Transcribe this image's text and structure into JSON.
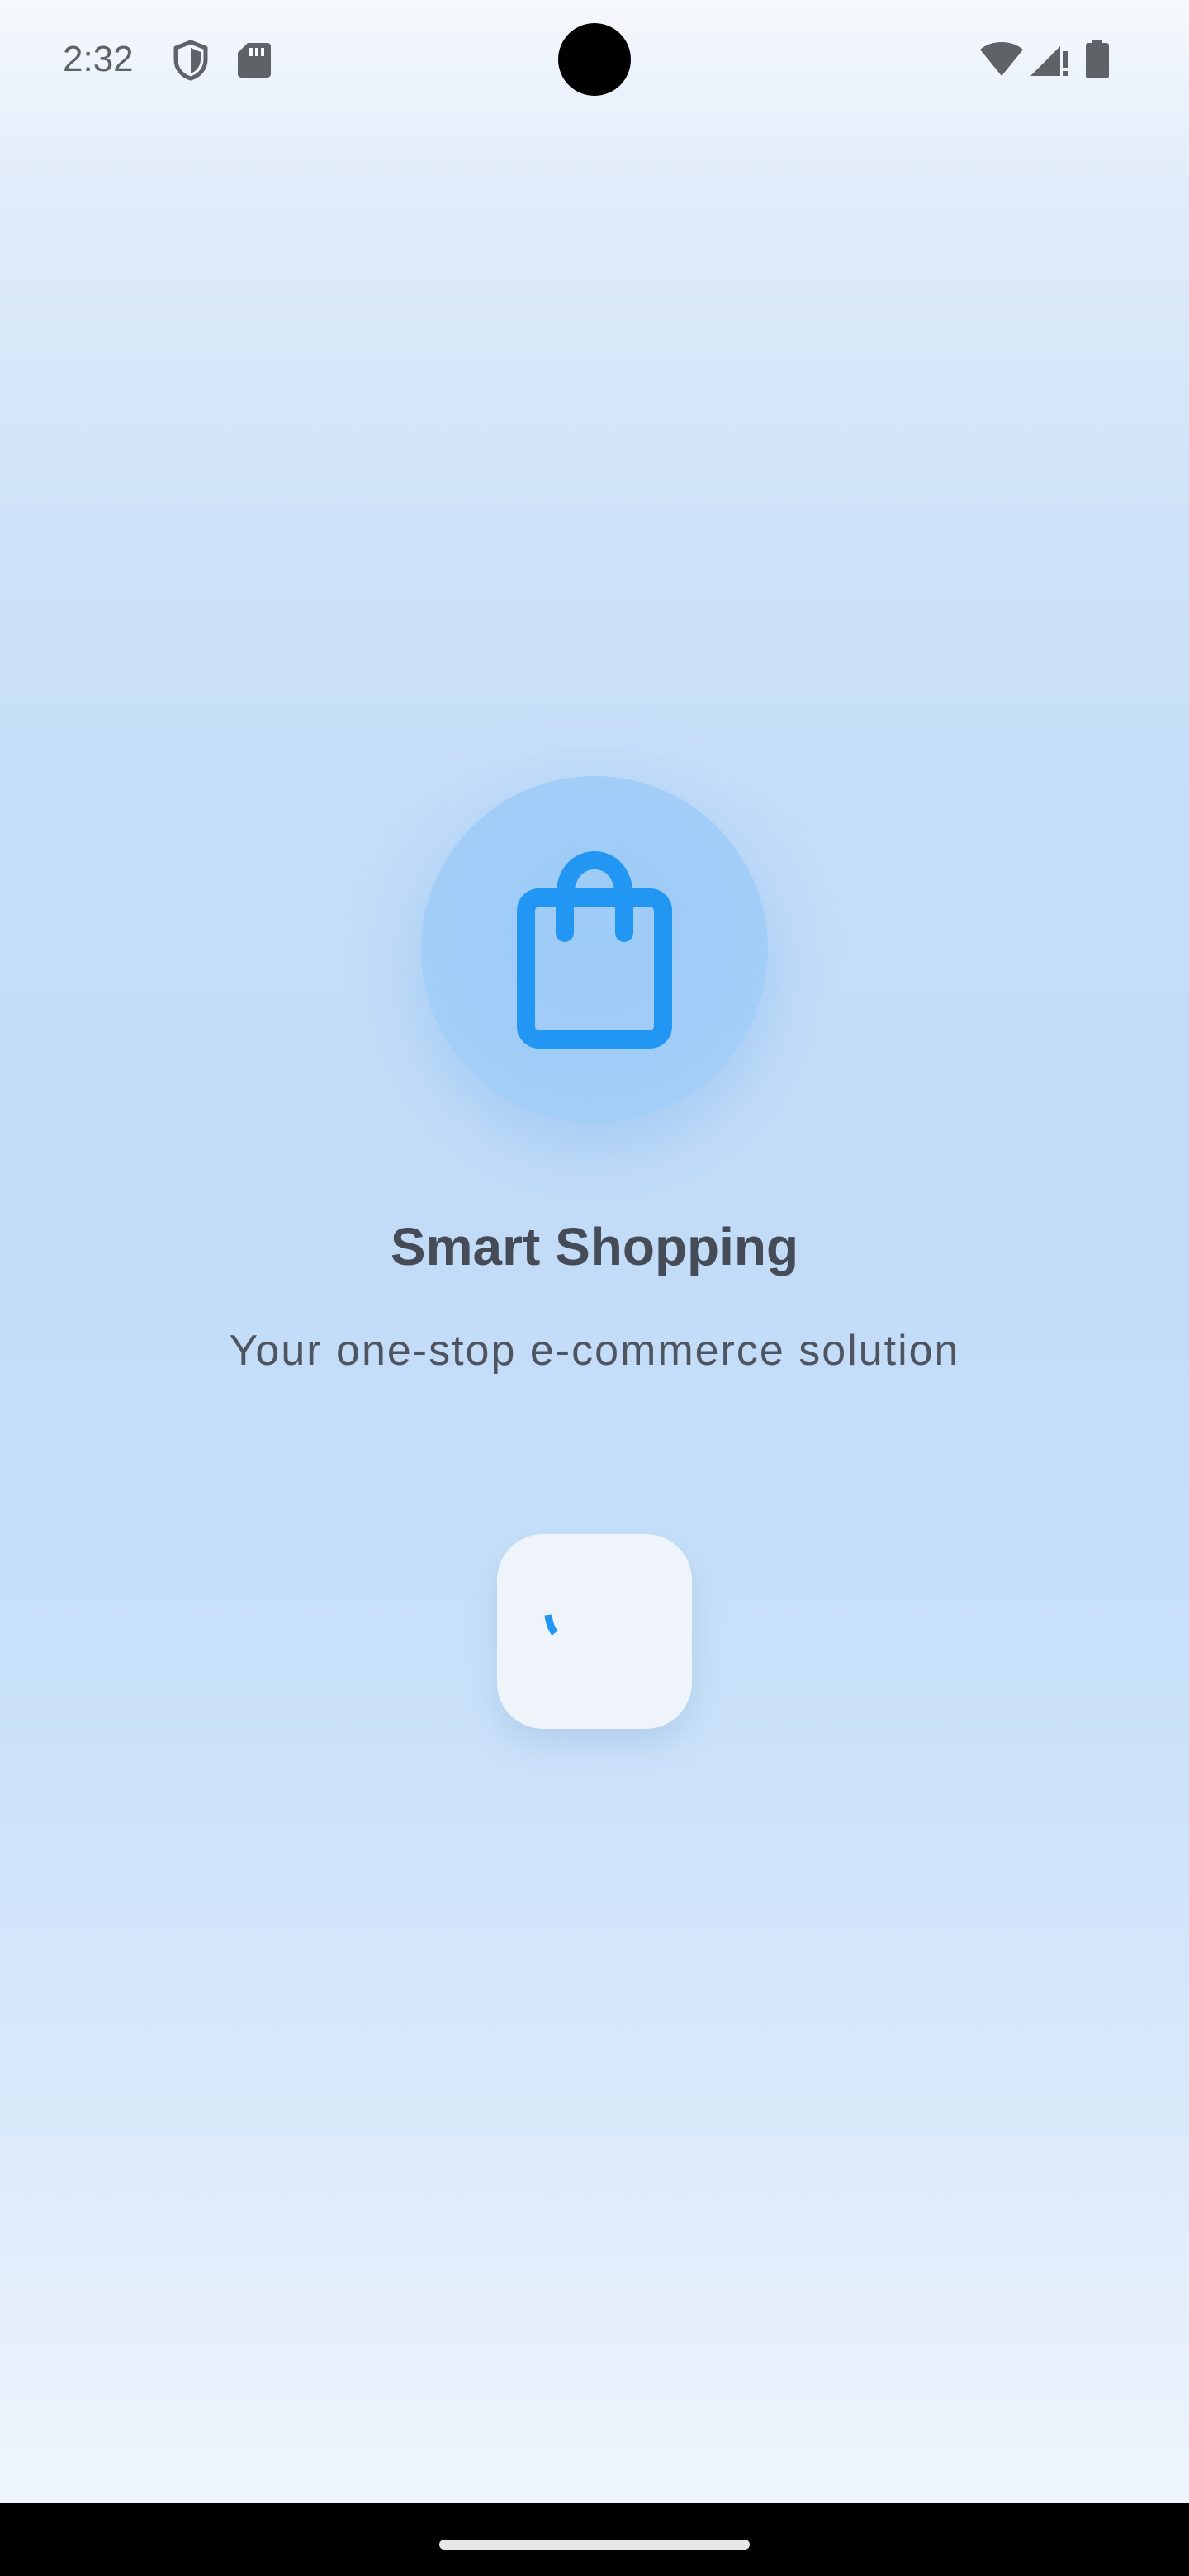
{
  "status_bar": {
    "time": "2:32",
    "icons": [
      "shield-icon",
      "sdcard-icon",
      "wifi-icon",
      "signal-icon",
      "battery-icon"
    ]
  },
  "logo": {
    "icon": "shopping-bag-icon",
    "accent_color": "#2196f3"
  },
  "app": {
    "title": "Smart Shopping",
    "subtitle": "Your one-stop e-commerce solution"
  },
  "loader": {
    "state": "loading",
    "icon": "spinner-icon"
  },
  "colors": {
    "accent": "#2196f3",
    "title_text": "#454b57",
    "subtitle_text": "#4f5560",
    "background_top": "#f6f9fd",
    "background_mid": "#c2dcf8",
    "background_bottom": "#eff5fc"
  }
}
